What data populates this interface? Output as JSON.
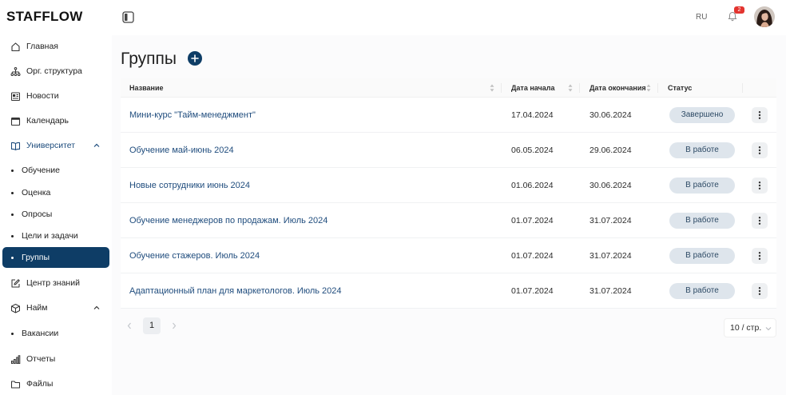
{
  "app": {
    "logo": "STAFFLOW"
  },
  "colors": {
    "accent": "#0e3d66",
    "link": "#1f4c7d",
    "status_badge_bg": "#dee5ec",
    "notification_badge": "#e3342f"
  },
  "sidebar": {
    "items": [
      {
        "label": "Главная",
        "icon": "home-icon"
      },
      {
        "label": "Орг. структура",
        "icon": "org-structure-icon"
      },
      {
        "label": "Новости",
        "icon": "news-icon"
      },
      {
        "label": "Календарь",
        "icon": "calendar-icon"
      },
      {
        "label": "Университет",
        "icon": "book-icon",
        "expanded": true,
        "children": [
          {
            "label": "Обучение"
          },
          {
            "label": "Оценка"
          },
          {
            "label": "Опросы"
          },
          {
            "label": "Цели и задачи"
          },
          {
            "label": "Группы",
            "active": true
          }
        ]
      },
      {
        "label": "Центр знаний",
        "icon": "edit-icon"
      },
      {
        "label": "Найм",
        "icon": "box-icon",
        "expanded": true,
        "children": [
          {
            "label": "Вакансии"
          }
        ]
      },
      {
        "label": "Отчеты",
        "icon": "chart-icon"
      },
      {
        "label": "Файлы",
        "icon": "folder-icon"
      }
    ]
  },
  "header": {
    "language": "RU",
    "notifications_count": "2"
  },
  "page": {
    "title": "Группы"
  },
  "table": {
    "columns": [
      "Название",
      "Дата начала",
      "Дата окончания",
      "Статус"
    ],
    "rows": [
      {
        "name": "Мини-курс \"Тайм-менеджмент\"",
        "start_date": "17.04.2024",
        "end_date": "30.06.2024",
        "status": "Завершено"
      },
      {
        "name": "Обучение май-июнь 2024",
        "start_date": "06.05.2024",
        "end_date": "29.06.2024",
        "status": "В работе"
      },
      {
        "name": "Новые сотрудники июнь 2024",
        "start_date": "01.06.2024",
        "end_date": "30.06.2024",
        "status": "В работе"
      },
      {
        "name": "Обучение менеджеров по продажам. Июль 2024",
        "start_date": "01.07.2024",
        "end_date": "31.07.2024",
        "status": "В работе"
      },
      {
        "name": "Обучение стажеров. Июль 2024",
        "start_date": "01.07.2024",
        "end_date": "31.07.2024",
        "status": "В работе"
      },
      {
        "name": "Адаптационный план для маркетологов. Июль 2024",
        "start_date": "01.07.2024",
        "end_date": "31.07.2024",
        "status": "В работе"
      }
    ]
  },
  "pagination": {
    "current_page": "1",
    "page_size": "10 / стр."
  }
}
